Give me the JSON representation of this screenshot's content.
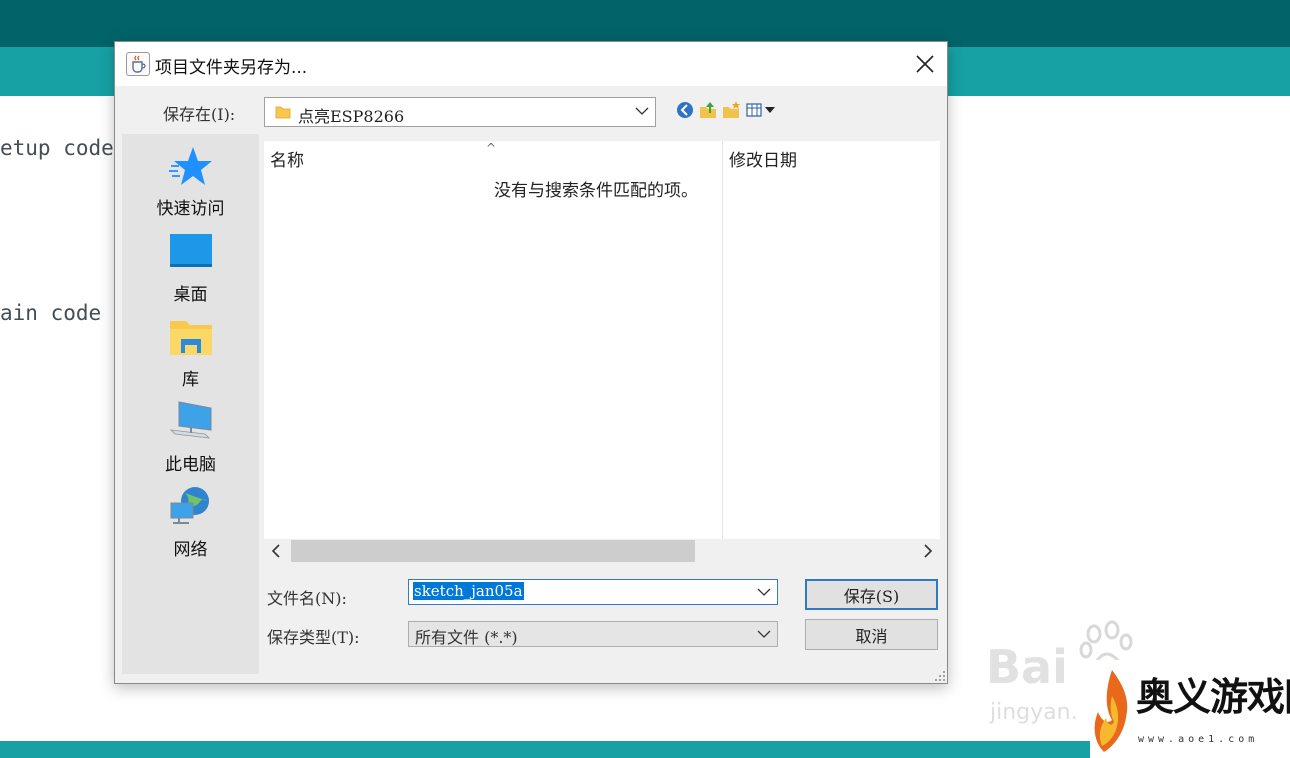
{
  "background": {
    "code_lines": [
      "etup code",
      "ain code"
    ],
    "colors": {
      "topbar": "#006468",
      "toolbar": "#17a1a5"
    }
  },
  "dialog": {
    "title": "项目文件夹另存为...",
    "title_icon": "java-cup-icon",
    "look_in": {
      "label": "保存在(I):",
      "value": "点亮ESP8266"
    },
    "toolbar_icons": [
      "back-icon",
      "up-folder-icon",
      "new-folder-icon",
      "view-menu-icon"
    ],
    "sidebar": {
      "items": [
        {
          "label": "快速访问",
          "icon": "star-icon"
        },
        {
          "label": "桌面",
          "icon": "desktop-icon"
        },
        {
          "label": "库",
          "icon": "library-icon"
        },
        {
          "label": "此电脑",
          "icon": "computer-icon"
        },
        {
          "label": "网络",
          "icon": "network-icon"
        }
      ]
    },
    "file_list": {
      "columns": [
        "名称",
        "修改日期"
      ],
      "empty_message": "没有与搜索条件匹配的项。"
    },
    "filename": {
      "label": "文件名(N):",
      "value": "sketch_jan05a"
    },
    "filetype": {
      "label": "保存类型(T):",
      "value": "所有文件 (*.*)"
    },
    "buttons": {
      "save": "保存(S)",
      "cancel": "取消"
    }
  },
  "watermarks": {
    "baidu": "Bai",
    "jingyan": "jingyan.",
    "site_title": "奥义游戏网",
    "site_url": "www.aoe1.com"
  }
}
